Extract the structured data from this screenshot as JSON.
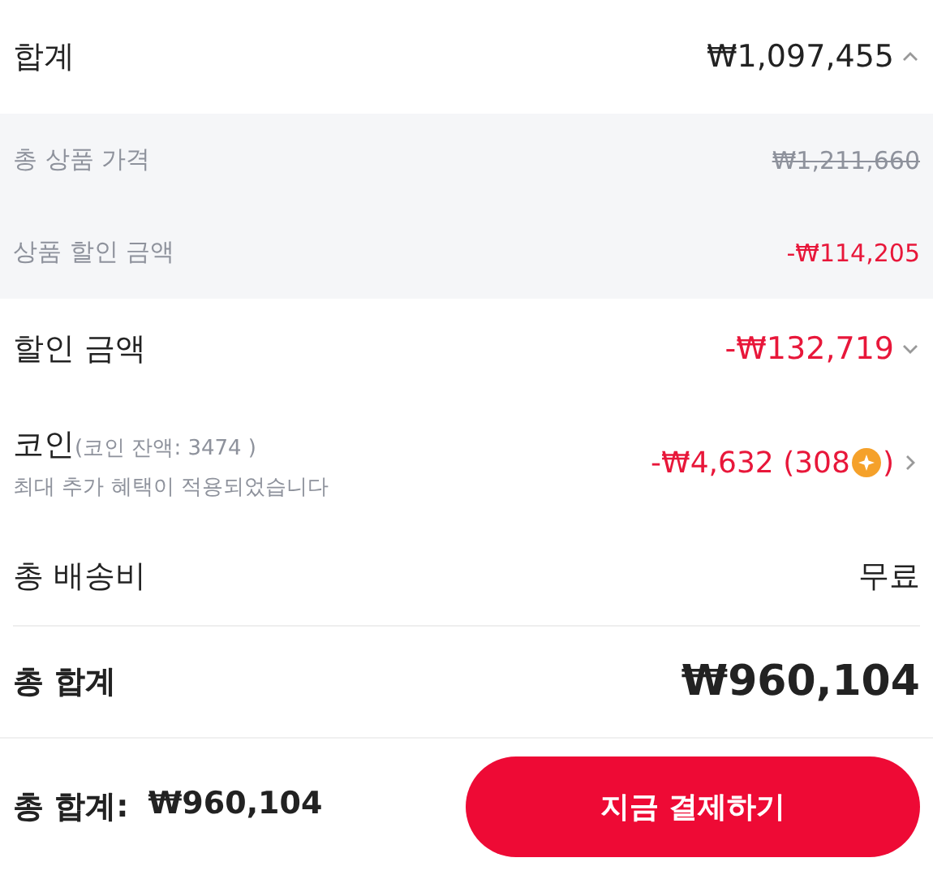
{
  "subtotal": {
    "label": "합계",
    "amount": "₩1,097,455",
    "expanded": true
  },
  "breakdown": [
    {
      "label": "총 상품 가격",
      "amount": "₩1,211,660",
      "kind": "original"
    },
    {
      "label": "상품 할인 금액",
      "amount": "-₩114,205",
      "kind": "discount"
    }
  ],
  "discount": {
    "label": "할인 금액",
    "amount": "-₩132,719",
    "expanded": false
  },
  "coin": {
    "label": "코인",
    "balance": "(코인 잔액: 3474 )",
    "note": "최대 추가 혜택이 적용되었습니다",
    "amount": "-₩4,632 (308",
    "amount_end": ")"
  },
  "shipping": {
    "label": "총 배송비",
    "value": "무료"
  },
  "total": {
    "label": "총 합계",
    "amount": "₩960,104"
  },
  "footer": {
    "label": "총 합계:",
    "amount": "₩960,104",
    "button": "지금 결제하기"
  }
}
